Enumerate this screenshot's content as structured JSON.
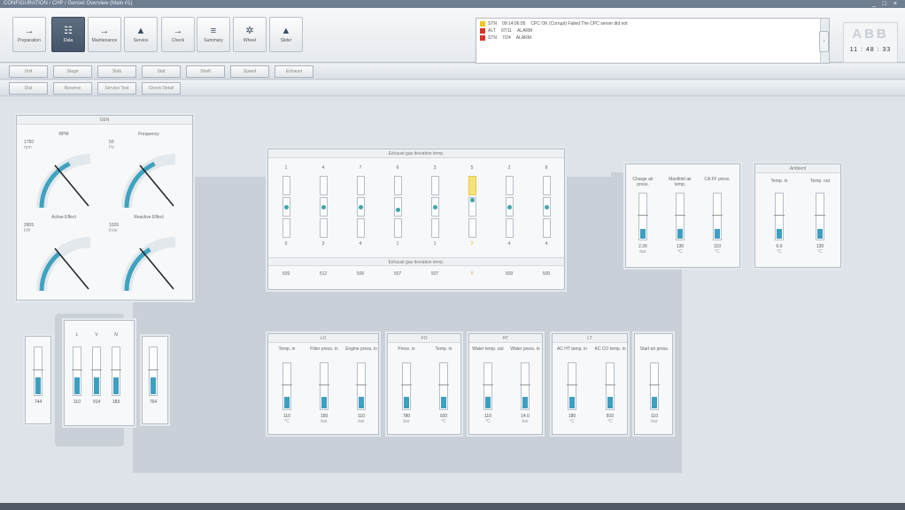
{
  "window": {
    "title": "CONFIGURATION / CHP / Genset Overview (Main #1)",
    "controls": "_ □ ×"
  },
  "nav": [
    {
      "label": "Preparation",
      "icon": "→"
    },
    {
      "label": "Data",
      "icon": "☷"
    },
    {
      "label": "Maintenance",
      "icon": "→"
    },
    {
      "label": "Service",
      "icon": "▲"
    },
    {
      "label": "Check",
      "icon": "→"
    },
    {
      "label": "Summary",
      "icon": "≡"
    },
    {
      "label": "Wheel",
      "icon": "✲"
    },
    {
      "label": "Slider",
      "icon": "▲"
    }
  ],
  "alarms": [
    {
      "marker": "yellow",
      "state": "STN",
      "time": "09:14:06:05",
      "text": "CPC OK (Corrupt) Failed  The CPC server did not"
    },
    {
      "marker": "red",
      "state": "ALT",
      "time": "07/11",
      "text": "ALARM"
    },
    {
      "marker": "red",
      "state": "STN",
      "time": "7/24",
      "text": "ALARM"
    }
  ],
  "brand": {
    "logo": "ABB",
    "clock": "11 : 48 : 33"
  },
  "tabs_row1": [
    "Unit",
    "Stage",
    "Stab",
    "Stat",
    "Shaft",
    "Speed",
    "Exhaust"
  ],
  "tabs_row2": [
    "Dial",
    "Reserve",
    "Service Test",
    "Check Detail"
  ],
  "gen_panel": {
    "title": "GEN",
    "gauges": [
      {
        "label": "RPM",
        "value": "1750",
        "unit": "rpm",
        "level": 0.72
      },
      {
        "label": "Frequency",
        "value": "50",
        "unit": "Hz",
        "level": 0.72
      },
      {
        "label": "Active Effect",
        "value": "2805",
        "unit": "kW",
        "level": 0.55
      },
      {
        "label": "Reactive Effect",
        "value": "1026",
        "unit": "kVar",
        "level": 0.65
      }
    ]
  },
  "exhaust_panel": {
    "title": "Exhaust gas deviation temp.",
    "subtitle": "Exhaust gas deviation temp.",
    "cylinders": [
      {
        "num": "1",
        "dev": "0",
        "temp": "509",
        "level": 0.5,
        "warn": false
      },
      {
        "num": "4",
        "dev": "3",
        "temp": "512",
        "level": 0.5,
        "warn": false
      },
      {
        "num": "7",
        "dev": "4",
        "temp": "506",
        "level": 0.5,
        "warn": false
      },
      {
        "num": "6",
        "dev": "1",
        "temp": "507",
        "level": 0.45,
        "warn": false
      },
      {
        "num": "3",
        "dev": "1",
        "temp": "507",
        "level": 0.5,
        "warn": false
      },
      {
        "num": "5",
        "dev": "2",
        "temp": "0",
        "level": 0.62,
        "warn": true
      },
      {
        "num": "2",
        "dev": "4",
        "temp": "509",
        "level": 0.5,
        "warn": false
      },
      {
        "num": "8",
        "dev": "4",
        "temp": "500",
        "level": 0.5,
        "warn": false
      }
    ]
  },
  "charge_panel": {
    "gauges": [
      {
        "label": "Charge air press.",
        "value": "2.26",
        "unit": "bar",
        "level": 0.22
      },
      {
        "label": "Manifold air temp.",
        "value": "130",
        "unit": "°C",
        "level": 0.22
      },
      {
        "label": "CA FF press.",
        "value": "110",
        "unit": "°C",
        "level": 0.22
      }
    ]
  },
  "ambient_panel": {
    "title": "Ambient",
    "gauges": [
      {
        "label": "Temp. in",
        "value": "6.0",
        "unit": "°C",
        "level": 0.22
      },
      {
        "label": "Temp. out",
        "value": "130",
        "unit": "°C",
        "level": 0.22
      }
    ]
  },
  "left_tubes": [
    {
      "label": "",
      "value": "744",
      "level": 0.36
    },
    {
      "label": "L",
      "value": "110",
      "level": 0.36
    },
    {
      "label": "V",
      "value": "914",
      "level": 0.36
    },
    {
      "label": "N",
      "value": "183",
      "level": 0.36
    },
    {
      "label": "",
      "value": "764",
      "level": 0.36
    }
  ],
  "bottom_panels": [
    {
      "title": "LO",
      "gauges": [
        {
          "label": "Temp. in",
          "value": "110",
          "unit": "°C",
          "level": 0.25
        },
        {
          "label": "Filter press. in",
          "value": "150",
          "unit": "bar",
          "level": 0.25
        },
        {
          "label": "Engine press. in",
          "value": "110",
          "unit": "bar",
          "level": 0.25
        }
      ]
    },
    {
      "title": "FO",
      "gauges": [
        {
          "label": "Press. in",
          "value": "780",
          "unit": "bar",
          "level": 0.25
        },
        {
          "label": "Temp. in",
          "value": "920",
          "unit": "°C",
          "level": 0.25
        }
      ]
    },
    {
      "title": "HT",
      "gauges": [
        {
          "label": "Water temp. out",
          "value": "110",
          "unit": "°C",
          "level": 0.25
        },
        {
          "label": "Water press. in",
          "value": "14.0",
          "unit": "bar",
          "level": 0.25
        }
      ]
    },
    {
      "title": "LT",
      "gauges": [
        {
          "label": "AC HT temp. in",
          "value": "180",
          "unit": "°C",
          "level": 0.25
        },
        {
          "label": "AC CO temp. in",
          "value": "810",
          "unit": "°C",
          "level": 0.25
        }
      ]
    },
    {
      "title": "",
      "gauges": [
        {
          "label": "Start air press.",
          "value": "110",
          "unit": "bar",
          "level": 0.25
        }
      ]
    }
  ],
  "colors": {
    "accent": "#3d9fc1",
    "teal": "#3fa7a6",
    "warn": "#f0d34a",
    "active_nav": "#4f5e72"
  }
}
